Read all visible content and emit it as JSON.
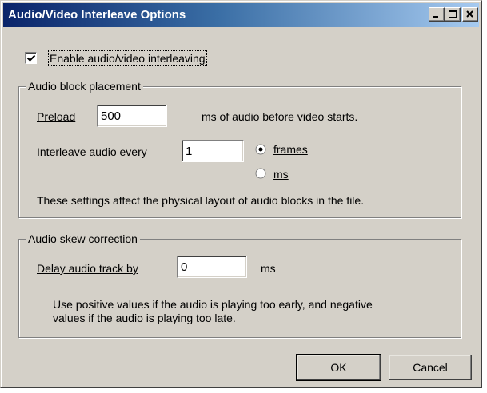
{
  "window": {
    "title": "Audio/Video Interleave Options"
  },
  "enable": {
    "label": "Enable audio/video interleaving",
    "checked": true
  },
  "block_placement": {
    "title": "Audio block placement",
    "preload_label": "Preload",
    "preload_value": "500",
    "preload_suffix": "ms of audio before video starts.",
    "interleave_label": "Interleave audio every",
    "interleave_value": "1",
    "unit_frames": "frames",
    "unit_ms": "ms",
    "selected_unit": "frames",
    "note": "These settings affect the physical layout of audio blocks in the file."
  },
  "skew": {
    "title": "Audio skew correction",
    "delay_label": "Delay audio track by",
    "delay_value": "0",
    "delay_unit": "ms",
    "note_line1": "Use positive values if the audio is playing too early, and negative",
    "note_line2": "values if the audio is playing too late."
  },
  "buttons": {
    "ok": "OK",
    "cancel": "Cancel"
  },
  "colors": {
    "face": "#d4d0c8",
    "title_start": "#0a246a",
    "title_end": "#a6caf0"
  }
}
